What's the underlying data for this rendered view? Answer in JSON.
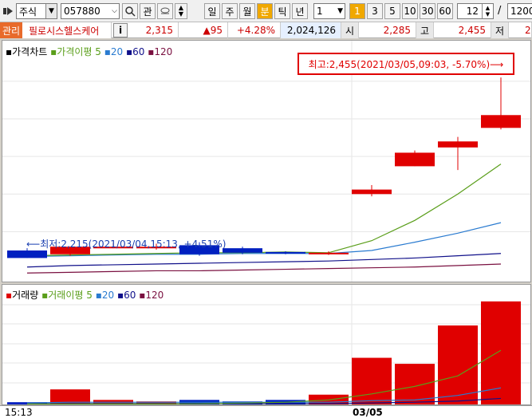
{
  "toolbar": {
    "market": "주식",
    "code": "057880",
    "interest_label": "관",
    "period_buttons": [
      "일",
      "주",
      "월",
      "분",
      "틱",
      "년"
    ],
    "active_period": "분",
    "interval_value": "1",
    "minute_buttons": [
      "1",
      "3",
      "5",
      "10",
      "30",
      "60"
    ],
    "active_minute": "1",
    "count_value": "12",
    "slash": "/",
    "total_value": "1200"
  },
  "quote": {
    "tag": "관리",
    "name": "필로시스헬스케어",
    "info_label": "i",
    "price": "2,315",
    "change": "▲95",
    "change_rate": "+4.28%",
    "volume": "2,024,126",
    "open_label": "시",
    "open": "2,285",
    "high_label": "고",
    "high": "2,455",
    "low_label": "저",
    "low": "2"
  },
  "price_pane": {
    "legend": {
      "title": "가격차트",
      "ma_label": "가격이평",
      "ma5": "5",
      "ma20": "20",
      "ma60": "60",
      "ma120": "120"
    },
    "high_annotation": "최고:2,455(2021/03/05,09:03, -5.70%)⟶",
    "low_annotation": "⟵최저:2,215(2021/03/04,15:13, +4.51%)"
  },
  "volume_pane": {
    "legend": {
      "title": "거래량",
      "ma_label": "거래이평",
      "ma5": "5",
      "ma20": "20",
      "ma60": "60",
      "ma120": "120"
    }
  },
  "time_axis": {
    "start": "15:13",
    "date": "03/05"
  },
  "colors": {
    "up": "#e00000",
    "down": "#0020c0",
    "ma5": "#5a9e1a",
    "ma20": "#2a7bd0",
    "ma60": "#10108a",
    "ma120": "#7a1040",
    "accent": "#f0a800"
  },
  "chart_data": {
    "type": "candlestick",
    "candles": [
      {
        "open": 2225,
        "high": 2228,
        "low": 2215,
        "close": 2215
      },
      {
        "open": 2220,
        "high": 2230,
        "low": 2218,
        "close": 2230
      },
      {
        "open": 2230,
        "high": 2235,
        "low": 2228,
        "close": 2230
      },
      {
        "open": 2228,
        "high": 2234,
        "low": 2226,
        "close": 2230
      },
      {
        "open": 2232,
        "high": 2236,
        "low": 2218,
        "close": 2220
      },
      {
        "open": 2228,
        "high": 2230,
        "low": 2220,
        "close": 2222
      },
      {
        "open": 2223,
        "high": 2224,
        "low": 2220,
        "close": 2222
      },
      {
        "open": 2221,
        "high": 2224,
        "low": 2219,
        "close": 2222
      },
      {
        "open": 2300,
        "high": 2312,
        "low": 2297,
        "close": 2306
      },
      {
        "open": 2337,
        "high": 2358,
        "low": 2337,
        "close": 2355
      },
      {
        "open": 2362,
        "high": 2376,
        "low": 2332,
        "close": 2370
      },
      {
        "open": 2388,
        "high": 2455,
        "low": 2386,
        "close": 2405
      }
    ],
    "ma5": [
      2218,
      2219,
      2220,
      2221,
      2222,
      2222,
      2223,
      2222,
      2238,
      2265,
      2300,
      2340
    ],
    "ma20": [
      2217,
      2218,
      2219,
      2220,
      2220,
      2221,
      2221,
      2221,
      2225,
      2236,
      2248,
      2262
    ],
    "ma60": [
      2203,
      2205,
      2206,
      2207,
      2208,
      2209,
      2210,
      2211,
      2213,
      2215,
      2218,
      2221
    ],
    "ma120": [
      2195,
      2196,
      2197,
      2198,
      2198,
      2199,
      2200,
      2201,
      2202,
      2203,
      2205,
      2207
    ],
    "volumes": [
      30,
      200,
      60,
      40,
      60,
      40,
      60,
      130,
      620,
      540,
      1050,
      1370
    ],
    "vol_ma5": [
      5,
      6,
      7,
      7,
      10,
      18,
      30,
      60,
      140,
      240,
      380,
      720
    ],
    "vol_ma20": [
      20,
      30,
      30,
      30,
      30,
      30,
      30,
      30,
      50,
      60,
      120,
      220
    ],
    "vol_ma60": [
      10,
      12,
      12,
      12,
      12,
      12,
      12,
      12,
      20,
      30,
      45,
      80
    ]
  }
}
